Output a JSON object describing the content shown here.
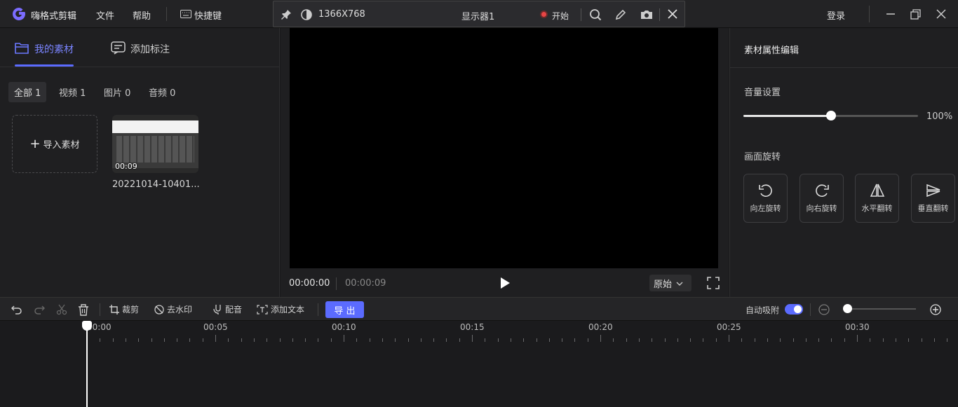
{
  "app": {
    "name": "嗨格式剪辑",
    "menu": [
      "文件",
      "帮助"
    ],
    "shortcut_label": "快捷键",
    "login": "登录",
    "brand_color": "#5b6bff"
  },
  "recorder": {
    "resolution": "1366X768",
    "display": "显示器1",
    "start": "开始"
  },
  "left": {
    "tabs": [
      "我的素材",
      "添加标注"
    ],
    "filters": [
      "全部 1",
      "视频 1",
      "图片 0",
      "音频 0"
    ],
    "import_label": "导入素材",
    "media": [
      {
        "name": "20221014-10401...",
        "duration": "00:09"
      }
    ]
  },
  "player": {
    "current": "00:00:00",
    "total": "00:00:09",
    "ratio": "原始"
  },
  "right": {
    "title": "素材属性编辑",
    "volume_label": "音量设置",
    "volume_value": "100%",
    "volume_level": 0.5,
    "rotate_label": "画面旋转",
    "rotate_buttons": [
      "向左旋转",
      "向右旋转",
      "水平翻转",
      "垂直翻转"
    ]
  },
  "toolbar": {
    "crop": "裁剪",
    "watermark": "去水印",
    "dub": "配音",
    "add_text": "添加文本",
    "export": "导 出",
    "snap_label": "自动吸附",
    "snap_on": true
  },
  "timeline": {
    "labels": [
      "00:00",
      "00:05",
      "00:10",
      "00:15",
      "00:20",
      "00:25",
      "00:30"
    ],
    "playhead": "00:00"
  }
}
